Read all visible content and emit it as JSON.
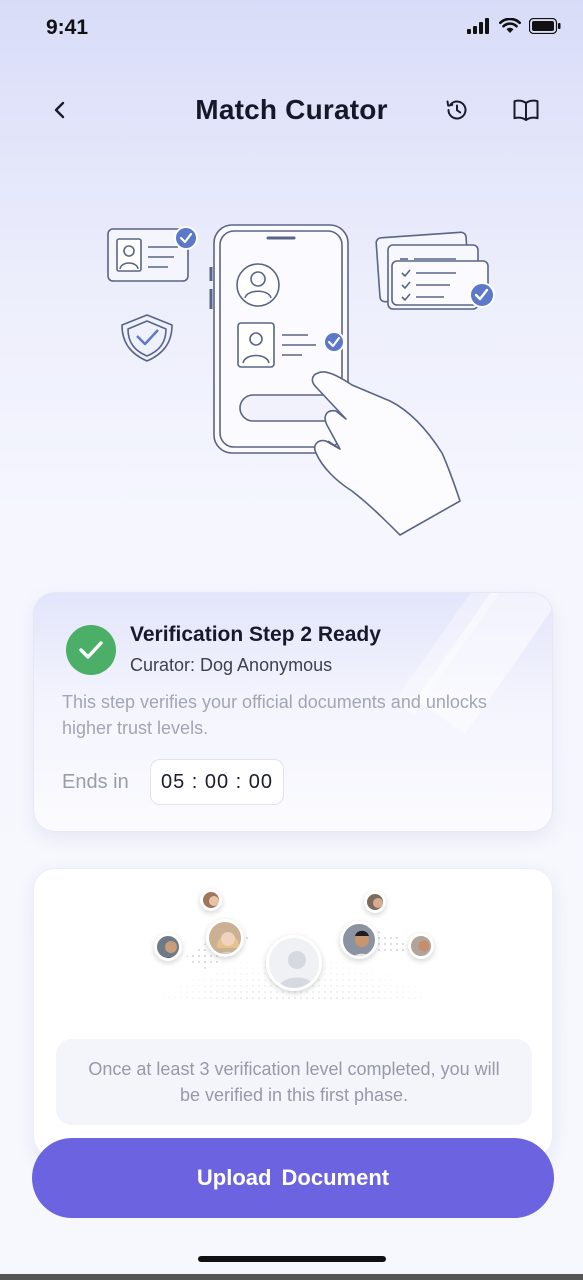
{
  "status_bar": {
    "time": "9:41"
  },
  "header": {
    "title": "Match Curator"
  },
  "verification": {
    "title": "Verification Step 2 Ready",
    "curator": "Curator: Dog Anonymous",
    "description": "This step verifies your official documents and unlocks higher trust levels.",
    "ends_label": "Ends in",
    "timer": "05 : 00 : 00"
  },
  "community": {
    "info_text": "Once at least 3 verification level completed, you will be verified in this first phase."
  },
  "action": {
    "upload_label": "Upload  Document"
  },
  "colors": {
    "accent": "#6b63e0",
    "success": "#4caf68",
    "badge_blue": "#5b78c9"
  }
}
